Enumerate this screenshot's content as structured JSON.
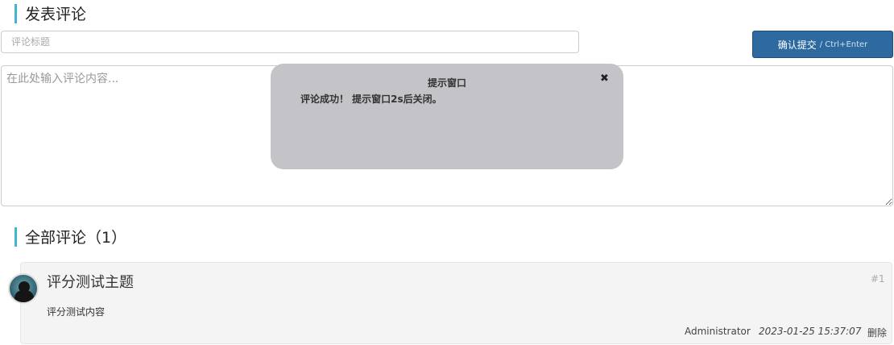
{
  "post_section": {
    "title": "发表评论"
  },
  "form": {
    "title_placeholder": "评论标题",
    "content_placeholder": "在此处输入评论内容...",
    "submit_label": "确认提交",
    "submit_hint": "/ Ctrl+Enter"
  },
  "popup": {
    "title": "提示窗口",
    "close_glyph": "✖",
    "message": "评论成功！ 提示窗口2s后关闭。"
  },
  "comments_section": {
    "title": "全部评论（1）"
  },
  "comments": [
    {
      "title": "评分测试主题",
      "number": "#1",
      "body": "评分测试内容",
      "author": "Administrator",
      "date": "2023-01-25 15:37:07",
      "delete_label": "删除"
    }
  ]
}
